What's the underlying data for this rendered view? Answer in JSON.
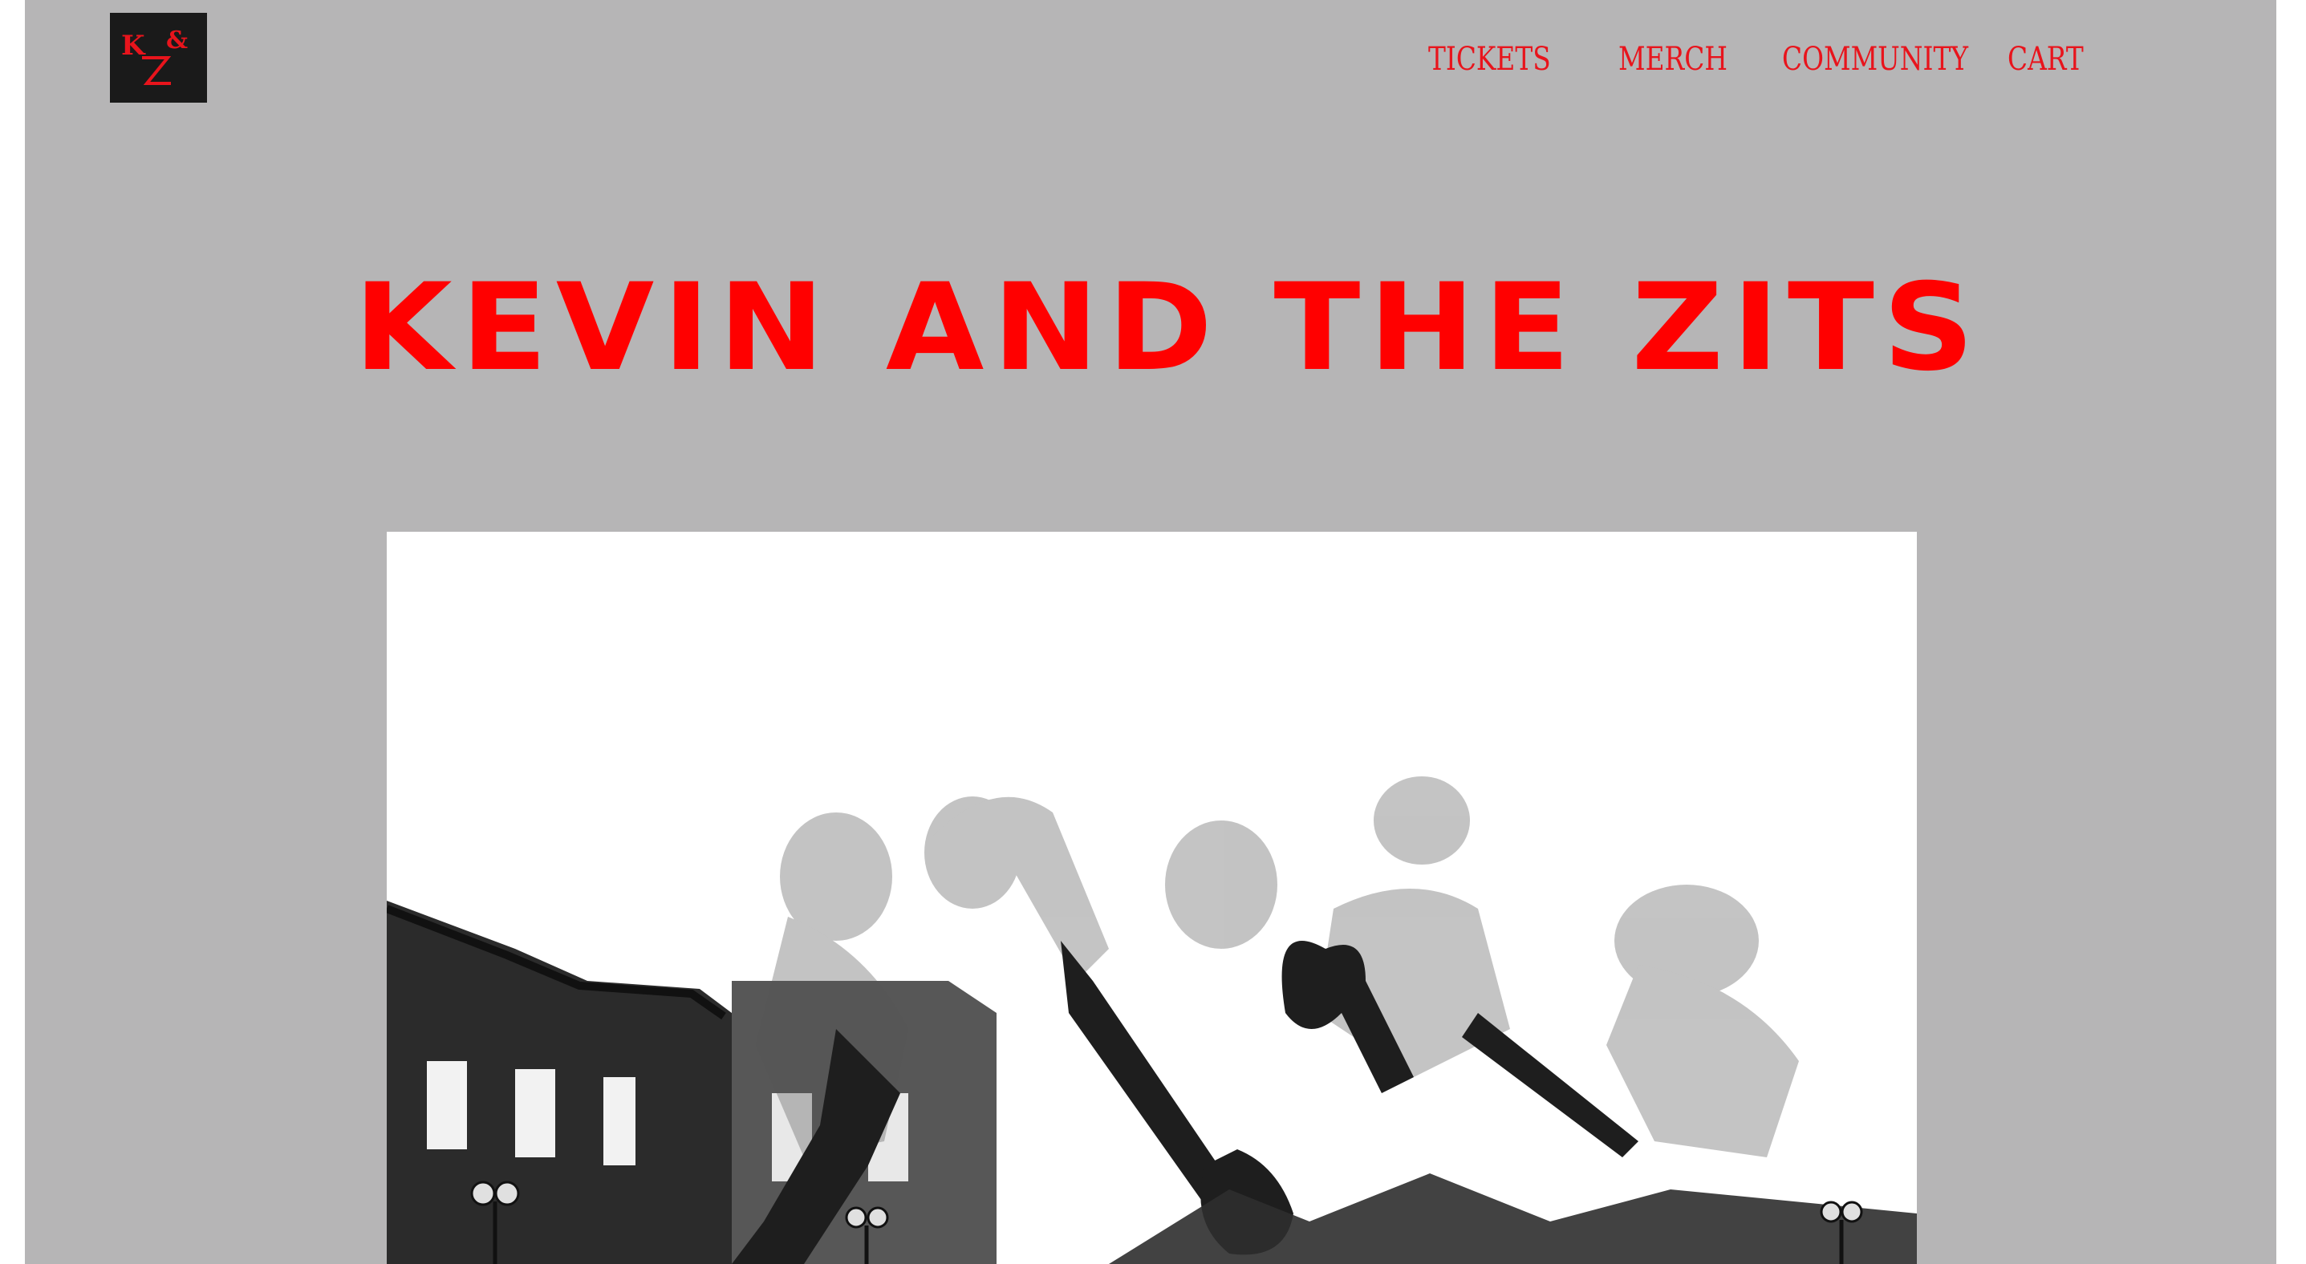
{
  "logo": {
    "text": "K&Z",
    "icon": "band-logo-icon",
    "bg_color": "#1a1a1a",
    "fg_color": "#e8141c"
  },
  "nav": {
    "items": [
      {
        "label": "TICKETS"
      },
      {
        "label": "MERCH"
      },
      {
        "label": "COMMUNITY"
      },
      {
        "label": "CART"
      }
    ]
  },
  "hero": {
    "title": "KEVIN AND THE ZITS"
  },
  "colors": {
    "page_bg": "#b6b5b6",
    "accent": "#ff0000",
    "nav_text": "#e8141c"
  }
}
